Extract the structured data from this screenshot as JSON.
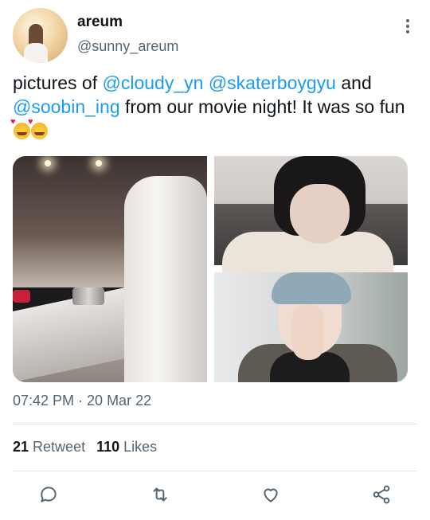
{
  "user": {
    "display_name": "areum",
    "handle": "@sunny_areum"
  },
  "tweet": {
    "text_prefix": "pictures of ",
    "mention_1": "@cloudy_yn",
    "mention_2": "@skaterboygyu",
    "text_and": " and ",
    "mention_3": "@soobin_ing",
    "text_suffix": " from our movie night! It was so fun",
    "emoji": [
      "smiling-face-with-hearts",
      "smiling-face-with-hearts"
    ]
  },
  "timestamp": "07:42 PM · 20 Mar 22",
  "stats": {
    "retweet_count": "21",
    "retweet_label": "Retweet",
    "likes_count": "110",
    "likes_label": "Likes"
  },
  "icons": [
    "more-icon",
    "reply-icon",
    "retweet-icon",
    "like-icon",
    "share-icon"
  ],
  "colors": {
    "mention": "#1d9bf0",
    "secondary_text": "#536471",
    "primary_text": "#0f1419"
  }
}
